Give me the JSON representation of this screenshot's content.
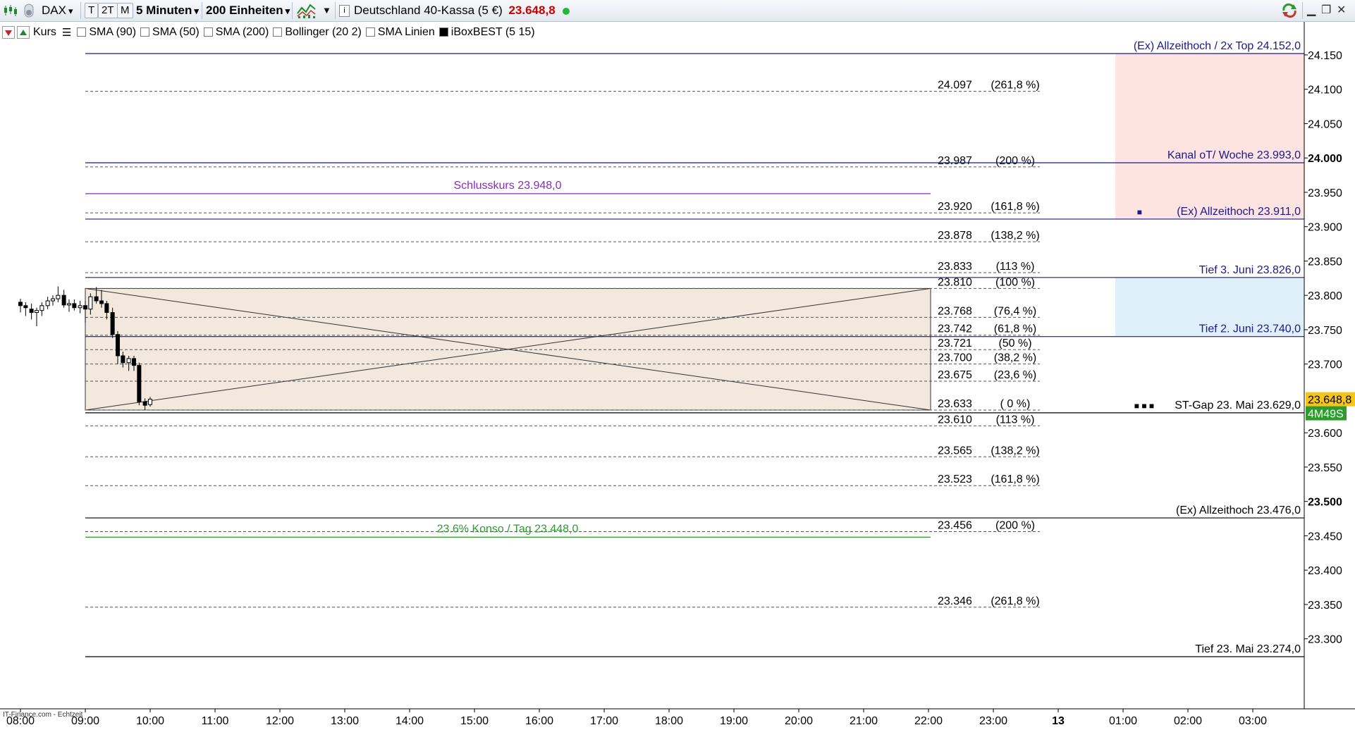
{
  "toolbar": {
    "symbol": "DAX",
    "range_buttons": [
      "T",
      "2T",
      "M"
    ],
    "interval": "5 Minuten",
    "units": "200 Einheiten",
    "instrument": "Deutschland 40-Kassa (5 €)",
    "price": "23.648,8",
    "price_color": "#cc0000"
  },
  "indicators": {
    "kurs": "Kurs",
    "items": [
      {
        "label": "SMA (90)",
        "checked": false
      },
      {
        "label": "SMA (50)",
        "checked": false
      },
      {
        "label": "SMA (200)",
        "checked": false
      },
      {
        "label": "Bollinger (20 2)",
        "checked": false
      },
      {
        "label": "SMA Linien",
        "checked": false
      },
      {
        "label": "iBoxBEST (5 15)",
        "checked": true
      }
    ]
  },
  "footer": {
    "source": "IT-Finance.com - Echtzeit"
  },
  "chart_data": {
    "type": "candlestick",
    "y_range": [
      23250,
      24175
    ],
    "y_ticks": [
      {
        "v": 24150,
        "label": "24.150",
        "bold": false
      },
      {
        "v": 24100,
        "label": "24.100",
        "bold": false
      },
      {
        "v": 24050,
        "label": "24.050",
        "bold": false
      },
      {
        "v": 24000,
        "label": "24.000",
        "bold": true
      },
      {
        "v": 23950,
        "label": "23.950",
        "bold": false
      },
      {
        "v": 23900,
        "label": "23.900",
        "bold": false
      },
      {
        "v": 23850,
        "label": "23.850",
        "bold": false
      },
      {
        "v": 23800,
        "label": "23.800",
        "bold": false
      },
      {
        "v": 23750,
        "label": "23.750",
        "bold": false
      },
      {
        "v": 23700,
        "label": "23.700",
        "bold": false
      },
      {
        "v": 23600,
        "label": "23.600",
        "bold": false
      },
      {
        "v": 23550,
        "label": "23.550",
        "bold": false
      },
      {
        "v": 23500,
        "label": "23.500",
        "bold": true
      },
      {
        "v": 23450,
        "label": "23.450",
        "bold": false
      },
      {
        "v": 23400,
        "label": "23.400",
        "bold": false
      },
      {
        "v": 23350,
        "label": "23.350",
        "bold": false
      },
      {
        "v": 23300,
        "label": "23.300",
        "bold": false
      }
    ],
    "x_ticks": [
      {
        "h": 8,
        "label": "08:00",
        "bold": false
      },
      {
        "h": 9,
        "label": "09:00",
        "bold": false
      },
      {
        "h": 10,
        "label": "10:00",
        "bold": false
      },
      {
        "h": 11,
        "label": "11:00",
        "bold": false
      },
      {
        "h": 12,
        "label": "12:00",
        "bold": false
      },
      {
        "h": 13,
        "label": "13:00",
        "bold": false
      },
      {
        "h": 14,
        "label": "14:00",
        "bold": false
      },
      {
        "h": 15,
        "label": "15:00",
        "bold": false
      },
      {
        "h": 16,
        "label": "16:00",
        "bold": false
      },
      {
        "h": 17,
        "label": "17:00",
        "bold": false
      },
      {
        "h": 18,
        "label": "18:00",
        "bold": false
      },
      {
        "h": 19,
        "label": "19:00",
        "bold": false
      },
      {
        "h": 20,
        "label": "20:00",
        "bold": false
      },
      {
        "h": 21,
        "label": "21:00",
        "bold": false
      },
      {
        "h": 22,
        "label": "22:00",
        "bold": false
      },
      {
        "h": 23,
        "label": "23:00",
        "bold": false
      },
      {
        "h": 24,
        "label": "13",
        "bold": true
      },
      {
        "h": 25,
        "label": "01:00",
        "bold": false
      },
      {
        "h": 26,
        "label": "02:00",
        "bold": false
      },
      {
        "h": 27,
        "label": "03:00",
        "bold": false
      }
    ],
    "last_price": {
      "value": 23648.8,
      "label": "23.648,8",
      "countdown": "4M49S"
    },
    "fib_levels": [
      {
        "v": 24097,
        "label": "24.097",
        "pct": "(261,8 %)"
      },
      {
        "v": 23987,
        "label": "23.987",
        "pct": "(200 %)"
      },
      {
        "v": 23920,
        "label": "23.920",
        "pct": "(161,8 %)"
      },
      {
        "v": 23878,
        "label": "23.878",
        "pct": "(138,2 %)"
      },
      {
        "v": 23833,
        "label": "23.833",
        "pct": "(113 %)"
      },
      {
        "v": 23810,
        "label": "23.810",
        "pct": "(100 %)"
      },
      {
        "v": 23768,
        "label": "23.768",
        "pct": "(76,4 %)"
      },
      {
        "v": 23742,
        "label": "23.742",
        "pct": "(61,8 %)"
      },
      {
        "v": 23721,
        "label": "23.721",
        "pct": "(50 %)"
      },
      {
        "v": 23700,
        "label": "23.700",
        "pct": "(38,2 %)"
      },
      {
        "v": 23675,
        "label": "23.675",
        "pct": "(23,6 %)"
      },
      {
        "v": 23633,
        "label": "23.633",
        "pct": "( 0 %)"
      },
      {
        "v": 23610,
        "label": "23.610",
        "pct": "(113 %)"
      },
      {
        "v": 23565,
        "label": "23.565",
        "pct": "(138,2 %)"
      },
      {
        "v": 23523,
        "label": "23.523",
        "pct": "(161,8 %)"
      },
      {
        "v": 23456,
        "label": "23.456",
        "pct": "(200 %)"
      },
      {
        "v": 23346,
        "label": "23.346",
        "pct": "(261,8 %)"
      }
    ],
    "levels": [
      {
        "v": 24152,
        "text": "(Ex) Allzeithoch / 2x Top 24.152,0",
        "color": "#1a1a8c",
        "marker": ""
      },
      {
        "v": 23993,
        "text": "Kanal oT/ Woche 23.993,0",
        "color": "#1a1a8c",
        "marker": ""
      },
      {
        "v": 23911,
        "text": "(Ex) Allzeithoch 23.911,0",
        "color": "#1a1a8c",
        "marker": "■"
      },
      {
        "v": 23826,
        "text": "Tief 3. Juni 23.826,0",
        "color": "#1a1a8c",
        "marker": ""
      },
      {
        "v": 23740,
        "text": "Tief 2. Juni 23.740,0",
        "color": "#1a1a8c",
        "marker": ""
      },
      {
        "v": 23629,
        "text": "ST-Gap 23. Mai 23.629,0",
        "color": "#000000",
        "marker": "■ ■ ■"
      },
      {
        "v": 23476,
        "text": "(Ex) Allzeithoch  23.476,0",
        "color": "#000000",
        "marker": ""
      },
      {
        "v": 23274,
        "text": "Tief 23. Mai 23.274,0",
        "color": "#000000",
        "marker": ""
      }
    ],
    "annotations": [
      {
        "v": 23948,
        "text": "Schlusskurs 23.948,0",
        "color": "#8a2bbf"
      },
      {
        "v": 23448,
        "text": "23.6% Konso / Tag 23.448,0",
        "color": "#2e9b2e"
      }
    ],
    "zones": [
      {
        "from": 23911,
        "to": 24152,
        "color": "#fde4e1"
      },
      {
        "from": 23740,
        "to": 23826,
        "color": "#dff0fb"
      }
    ],
    "box": {
      "high": 23810,
      "low": 23633,
      "color": "#f2e8dd"
    },
    "candles": [
      {
        "t": 8.0,
        "o": 23790,
        "h": 23795,
        "l": 23775,
        "c": 23785
      },
      {
        "t": 8.08,
        "o": 23785,
        "h": 23790,
        "l": 23770,
        "c": 23782
      },
      {
        "t": 8.17,
        "o": 23780,
        "h": 23788,
        "l": 23765,
        "c": 23775
      },
      {
        "t": 8.25,
        "o": 23775,
        "h": 23782,
        "l": 23755,
        "c": 23778
      },
      {
        "t": 8.33,
        "o": 23778,
        "h": 23790,
        "l": 23770,
        "c": 23785
      },
      {
        "t": 8.42,
        "o": 23785,
        "h": 23798,
        "l": 23780,
        "c": 23792
      },
      {
        "t": 8.5,
        "o": 23792,
        "h": 23800,
        "l": 23785,
        "c": 23795
      },
      {
        "t": 8.58,
        "o": 23795,
        "h": 23813,
        "l": 23790,
        "c": 23800
      },
      {
        "t": 8.67,
        "o": 23800,
        "h": 23808,
        "l": 23782,
        "c": 23786
      },
      {
        "t": 8.75,
        "o": 23786,
        "h": 23794,
        "l": 23776,
        "c": 23788
      },
      {
        "t": 8.83,
        "o": 23788,
        "h": 23794,
        "l": 23778,
        "c": 23782
      },
      {
        "t": 8.92,
        "o": 23782,
        "h": 23792,
        "l": 23774,
        "c": 23785
      },
      {
        "t": 9.0,
        "o": 23785,
        "h": 23792,
        "l": 23760,
        "c": 23780
      },
      {
        "t": 9.08,
        "o": 23780,
        "h": 23803,
        "l": 23772,
        "c": 23798
      },
      {
        "t": 9.17,
        "o": 23798,
        "h": 23812,
        "l": 23788,
        "c": 23792
      },
      {
        "t": 9.25,
        "o": 23792,
        "h": 23808,
        "l": 23782,
        "c": 23788
      },
      {
        "t": 9.33,
        "o": 23788,
        "h": 23792,
        "l": 23765,
        "c": 23775
      },
      {
        "t": 9.42,
        "o": 23775,
        "h": 23782,
        "l": 23738,
        "c": 23743
      },
      {
        "t": 9.5,
        "o": 23743,
        "h": 23748,
        "l": 23700,
        "c": 23712
      },
      {
        "t": 9.58,
        "o": 23712,
        "h": 23718,
        "l": 23695,
        "c": 23702
      },
      {
        "t": 9.67,
        "o": 23702,
        "h": 23712,
        "l": 23690,
        "c": 23708
      },
      {
        "t": 9.75,
        "o": 23708,
        "h": 23712,
        "l": 23690,
        "c": 23698
      },
      {
        "t": 9.83,
        "o": 23698,
        "h": 23702,
        "l": 23640,
        "c": 23645
      },
      {
        "t": 9.92,
        "o": 23645,
        "h": 23650,
        "l": 23633,
        "c": 23640
      },
      {
        "t": 10.0,
        "o": 23641,
        "h": 23652,
        "l": 23638,
        "c": 23648.8
      }
    ]
  }
}
